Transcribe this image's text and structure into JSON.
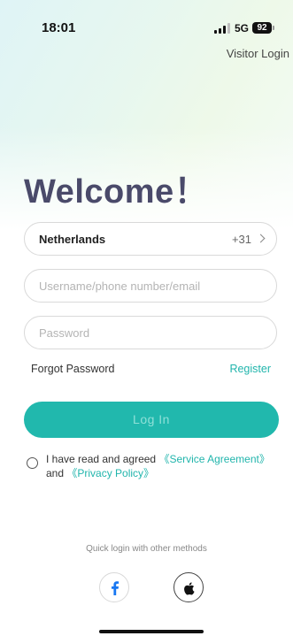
{
  "status_bar": {
    "time": "18:01",
    "network": "5G",
    "battery": "92"
  },
  "header": {
    "visitor_login": "Visitor Login"
  },
  "welcome": "Welcome！",
  "form": {
    "country_name": "Netherlands",
    "country_code": "+31",
    "username_placeholder": "Username/phone number/email",
    "password_placeholder": "Password",
    "forgot_password": "Forgot Password",
    "register": "Register",
    "login_button": "Log In"
  },
  "agreement": {
    "prefix": "I have read and agreed ",
    "service_agreement": "《Service Agreement》",
    "and": " and ",
    "privacy_policy": "《Privacy Policy》"
  },
  "quick_login": {
    "label": "Quick login with other methods",
    "methods": [
      "facebook-icon",
      "apple-icon"
    ]
  },
  "colors": {
    "accent": "#21b8ad",
    "title": "#4a4a6a"
  }
}
